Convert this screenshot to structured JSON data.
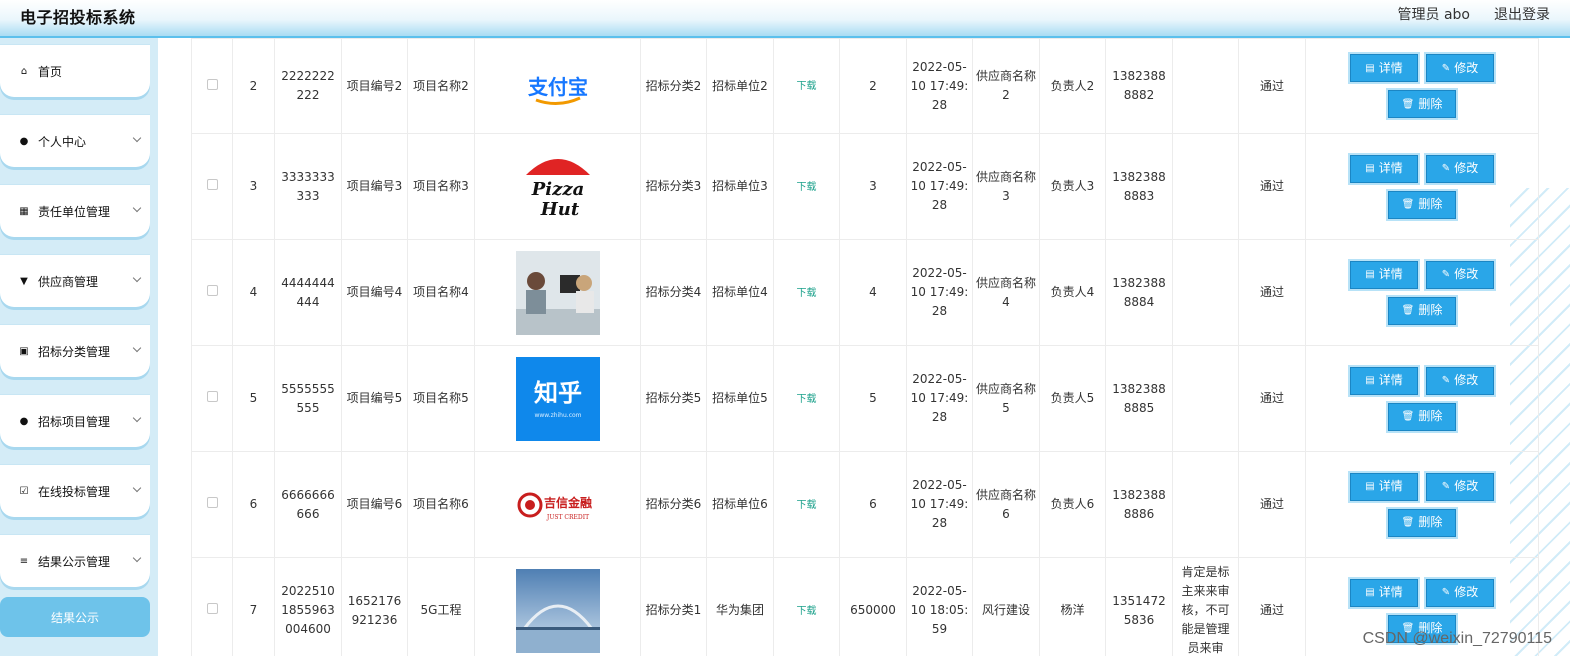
{
  "header": {
    "title": "电子招投标系统",
    "admin": "管理员 abo",
    "logout": "退出登录"
  },
  "sidebar": {
    "items": [
      {
        "label": "首页",
        "icon": "home-icon"
      },
      {
        "label": "个人中心",
        "icon": "person-icon"
      },
      {
        "label": "责任单位管理",
        "icon": "grid-icon"
      },
      {
        "label": "供应商管理",
        "icon": "shop-icon"
      },
      {
        "label": "招标分类管理",
        "icon": "clipboard-icon"
      },
      {
        "label": "招标项目管理",
        "icon": "person-icon"
      },
      {
        "label": "在线投标管理",
        "icon": "clipboard-check-icon"
      },
      {
        "label": "结果公示管理",
        "icon": "list-icon"
      }
    ],
    "active_sub": "结果公示"
  },
  "buttons": {
    "detail": "详情",
    "edit": "修改",
    "delete": "删除"
  },
  "download_label": "下载",
  "rows": [
    {
      "id": "2",
      "no": "2222222222",
      "code": "项目编号2",
      "name": "项目名称2",
      "logo": "alipay",
      "logo_text": "支付宝",
      "category": "招标分类2",
      "unit": "招标单位2",
      "amount": "2",
      "time": "2022-05-10 17:49:28",
      "supplier": "供应商名称2",
      "person": "负责人2",
      "phone": "13823888882",
      "note": "",
      "status": "通过"
    },
    {
      "id": "3",
      "no": "3333333333",
      "code": "项目编号3",
      "name": "项目名称3",
      "logo": "pizzahut",
      "logo_text": "Pizza Hut",
      "category": "招标分类3",
      "unit": "招标单位3",
      "amount": "3",
      "time": "2022-05-10 17:49:28",
      "supplier": "供应商名称3",
      "person": "负责人3",
      "phone": "13823888883",
      "note": "",
      "status": "通过"
    },
    {
      "id": "4",
      "no": "4444444444",
      "code": "项目编号4",
      "name": "项目名称4",
      "logo": "office",
      "logo_text": "",
      "category": "招标分类4",
      "unit": "招标单位4",
      "amount": "4",
      "time": "2022-05-10 17:49:28",
      "supplier": "供应商名称4",
      "person": "负责人4",
      "phone": "13823888884",
      "note": "",
      "status": "通过"
    },
    {
      "id": "5",
      "no": "5555555555",
      "code": "项目编号5",
      "name": "项目名称5",
      "logo": "zhihu",
      "logo_text": "知乎",
      "logo_sub": "www.zhihu.com",
      "category": "招标分类5",
      "unit": "招标单位5",
      "amount": "5",
      "time": "2022-05-10 17:49:28",
      "supplier": "供应商名称5",
      "person": "负责人5",
      "phone": "13823888885",
      "note": "",
      "status": "通过"
    },
    {
      "id": "6",
      "no": "6666666666",
      "code": "项目编号6",
      "name": "项目名称6",
      "logo": "jixin",
      "logo_text": "吉信金融",
      "logo_sub": "JUST CREDIT",
      "category": "招标分类6",
      "unit": "招标单位6",
      "amount": "6",
      "time": "2022-05-10 17:49:28",
      "supplier": "供应商名称6",
      "person": "负责人6",
      "phone": "13823888886",
      "note": "",
      "status": "通过"
    },
    {
      "id": "7",
      "no": "20225101855963004600",
      "code": "1652176921236",
      "name": "5G工程",
      "logo": "bridge",
      "logo_text": "",
      "category": "招标分类1",
      "unit": "华为集团",
      "amount": "650000",
      "time": "2022-05-10 18:05:59",
      "supplier": "风行建设",
      "person": "杨洋",
      "phone": "13514725836",
      "note": "肯定是标主来来审核，不可能是管理员来审",
      "status": "通过"
    }
  ],
  "watermark": "CSDN @weixin_72790115",
  "colors": {
    "accent": "#2aa6e8",
    "sidebar_bg": "#d4ecf7",
    "active": "#6ec3ea",
    "download": "#19a08a"
  }
}
